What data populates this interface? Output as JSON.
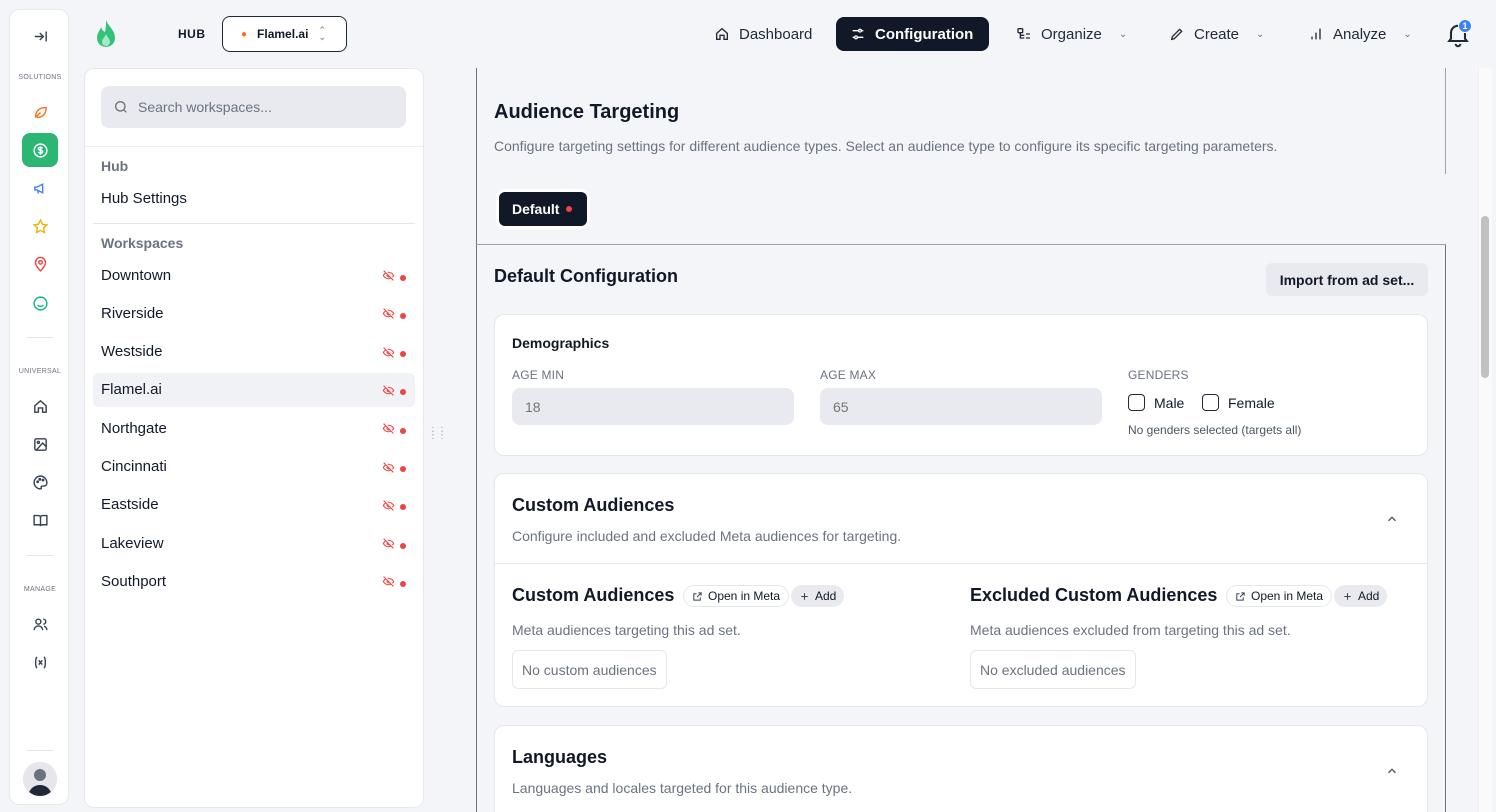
{
  "rail": {
    "sections": {
      "solutions": "SOLUTIONS",
      "universal": "UNIVERSAL",
      "manage": "MANAGE"
    },
    "colors": {
      "active_bg": "#2bb673",
      "leaf": "#f97316",
      "megaphone": "#3b82f6",
      "star": "#eab308",
      "pin": "#ef4444",
      "smile": "#10b981"
    }
  },
  "topbar": {
    "hub_label": "HUB",
    "workspace_select": "Flamel.ai",
    "nav": {
      "dashboard": "Dashboard",
      "configuration": "Configuration",
      "organize": "Organize",
      "create": "Create",
      "analyze": "Analyze"
    },
    "notification_count": "1"
  },
  "sidebar": {
    "search_placeholder": "Search workspaces...",
    "hub_heading": "Hub",
    "hub_settings": "Hub Settings",
    "workspaces_heading": "Workspaces",
    "workspaces": [
      {
        "name": "Downtown"
      },
      {
        "name": "Riverside"
      },
      {
        "name": "Westside"
      },
      {
        "name": "Flamel.ai",
        "selected": true
      },
      {
        "name": "Northgate"
      },
      {
        "name": "Cincinnati"
      },
      {
        "name": "Eastside"
      },
      {
        "name": "Lakeview"
      },
      {
        "name": "Southport"
      }
    ]
  },
  "main": {
    "title": "Audience Targeting",
    "description": "Configure targeting settings for different audience types. Select an audience type to configure its specific targeting parameters.",
    "default_tab": "Default",
    "config_title": "Default Configuration",
    "import_button": "Import from ad set...",
    "demographics": {
      "title": "Demographics",
      "age_min_label": "AGE MIN",
      "age_min_value": "18",
      "age_max_label": "AGE MAX",
      "age_max_value": "65",
      "genders_label": "GENDERS",
      "male": "Male",
      "female": "Female",
      "genders_hint": "No genders selected (targets all)"
    },
    "custom_audiences": {
      "title": "Custom Audiences",
      "description": "Configure included and excluded Meta audiences for targeting.",
      "included_title": "Custom Audiences",
      "included_desc": "Meta audiences targeting this ad set.",
      "included_empty": "No custom audiences",
      "excluded_title": "Excluded Custom Audiences",
      "excluded_desc": "Meta audiences excluded from targeting this ad set.",
      "excluded_empty": "No excluded audiences",
      "open_in_meta": "Open in Meta",
      "add": "Add"
    },
    "languages": {
      "title": "Languages",
      "description": "Languages and locales targeted for this audience type."
    }
  }
}
